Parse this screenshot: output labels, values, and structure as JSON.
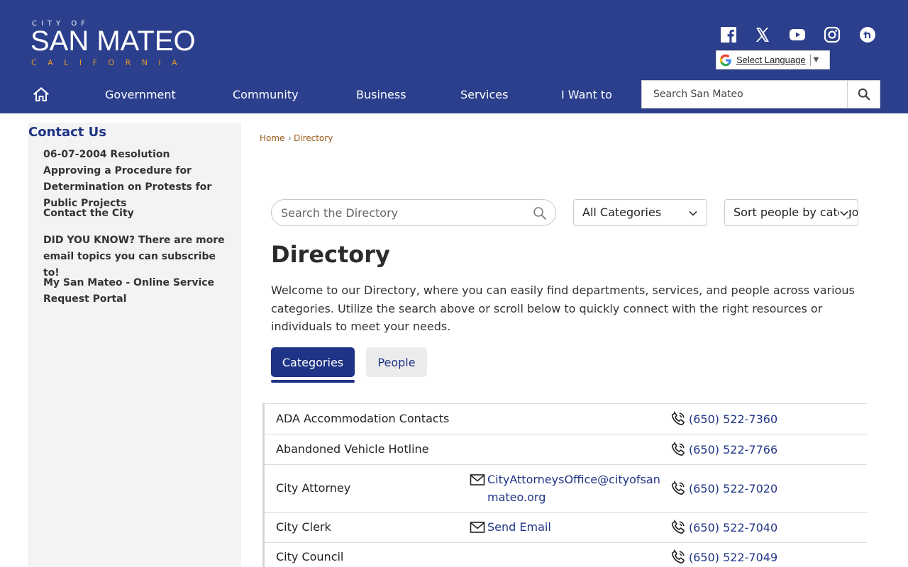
{
  "header": {
    "logo": {
      "top": "CITY OF",
      "name": "SAN MATEO",
      "bottom": "CALIFORNIA"
    },
    "social": [
      {
        "name": "facebook-icon"
      },
      {
        "name": "x-twitter-icon"
      },
      {
        "name": "youtube-icon"
      },
      {
        "name": "instagram-icon"
      },
      {
        "name": "nextdoor-icon"
      }
    ],
    "language": {
      "label": "Select Language",
      "arrow": "▼"
    },
    "nav": [
      "Government",
      "Community",
      "Business",
      "Services",
      "I Want to"
    ],
    "search_placeholder": "Search San Mateo"
  },
  "sidebar": {
    "title": "Contact Us",
    "links": [
      "06-07-2004 Resolution Approving a Procedure for Determination on Protests for Public Projects",
      "Contact the City",
      "DID YOU KNOW? There are more email topics you can subscribe to!",
      "My San Mateo - Online Service Request Portal"
    ]
  },
  "breadcrumb": {
    "home": "Home",
    "sep": "›",
    "current": "Directory"
  },
  "directory": {
    "search_placeholder": "Search the Directory",
    "category_select": "All Categories",
    "sort_select": "Sort people by category",
    "title": "Directory",
    "intro": "Welcome to our Directory, where you can easily find departments, services, and people across various categories. Utilize the search above or scroll below to quickly connect with the right resources or individuals to meet your needs.",
    "tabs": {
      "active": "Categories",
      "inactive": "People"
    },
    "rows": [
      {
        "name": "ADA Accommodation Contacts",
        "email": "",
        "phone": "(650) 522-7360"
      },
      {
        "name": "Abandoned Vehicle Hotline",
        "email": "",
        "phone": "(650) 522-7766"
      },
      {
        "name": "City Attorney",
        "email": "CityAttorneysOffice@cityofsanmateo.org",
        "phone": "(650) 522-7020"
      },
      {
        "name": "City Clerk",
        "email": "Send Email",
        "phone": "(650) 522-7040"
      },
      {
        "name": "City Council",
        "email": "",
        "phone": "(650) 522-7049"
      }
    ]
  }
}
